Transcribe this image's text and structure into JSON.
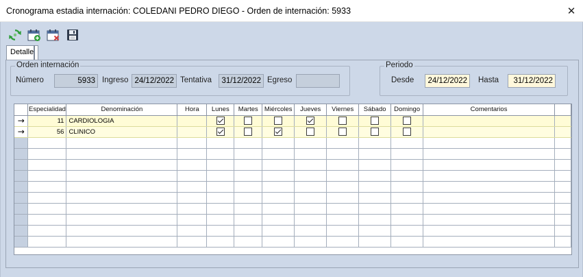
{
  "window": {
    "title": "Cronograma estadia internación: COLEDANI PEDRO DIEGO - Orden de internación: 5933",
    "close_glyph": "✕"
  },
  "toolbar": {
    "icons": [
      "refresh-icon",
      "calendar-add-icon",
      "calendar-delete-icon",
      "save-icon"
    ]
  },
  "tab": {
    "label": "Detalle"
  },
  "orden": {
    "legend": "Orden internación",
    "numero_label": "Número",
    "numero_value": "5933",
    "ingreso_label": "Ingreso",
    "ingreso_value": "24/12/2022",
    "tentativa_label": "Tentativa",
    "tentativa_value": "31/12/2022",
    "egreso_label": "Egreso",
    "egreso_value": ""
  },
  "periodo": {
    "legend": "Periodo",
    "desde_label": "Desde",
    "desde_value": "24/12/2022",
    "hasta_label": "Hasta",
    "hasta_value": "31/12/2022"
  },
  "grid": {
    "columns": [
      "",
      "Especialidad",
      "Denominación",
      "Hora",
      "Lunes",
      "Martes",
      "Miércoles",
      "Jueves",
      "Viernes",
      "Sábado",
      "Domingo",
      "Comentarios",
      ""
    ],
    "rows": [
      {
        "indicator": "→",
        "especialidad": "11",
        "denominacion": "CARDIOLOGIA",
        "hora": "",
        "lunes": true,
        "martes": false,
        "miercoles": false,
        "jueves": true,
        "viernes": false,
        "sabado": false,
        "domingo": false,
        "comentarios": ""
      },
      {
        "indicator": "→",
        "especialidad": "56",
        "denominacion": "CLINICO",
        "hora": "",
        "lunes": true,
        "martes": false,
        "miercoles": true,
        "jueves": false,
        "viernes": false,
        "sabado": false,
        "domingo": false,
        "comentarios": ""
      }
    ],
    "empty_rows": 10
  },
  "colors": {
    "window_bg": "#cdd8e8",
    "field_yellow": "#fff8dc",
    "field_readonly": "#c5cfdc",
    "refresh_green": "#2e9e3a"
  }
}
